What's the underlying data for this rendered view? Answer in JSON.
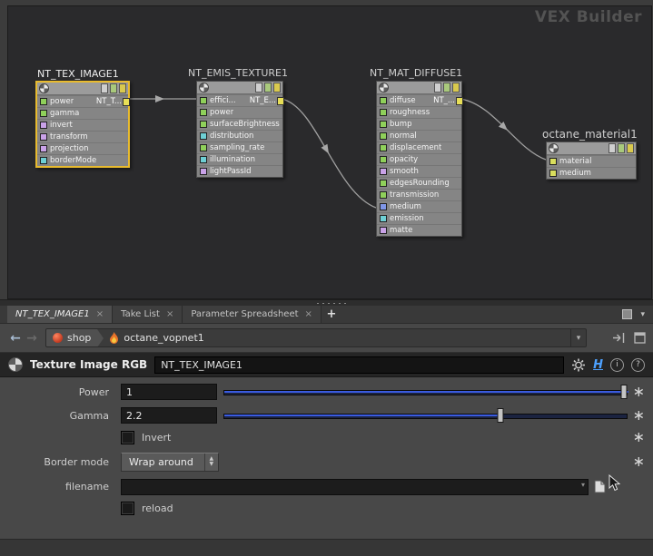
{
  "colors": {
    "selection_outline": "#e8bb2e",
    "slider_blue": "#3a5be0",
    "network_bg": "#2a2a2c",
    "pane_bg": "#484848"
  },
  "icons": {
    "back": "←",
    "forward": "→",
    "caret_down": "▾",
    "plus": "+",
    "close": "×",
    "spin_up": "▲",
    "spin_down": "▼",
    "star": "∗",
    "info": "i",
    "help": "?"
  },
  "network": {
    "watermark": "VEX Builder",
    "nodes": [
      {
        "title": "NT_TEX_IMAGE1",
        "abbrev": "NT_T...",
        "rows": [
          {
            "label": "power",
            "color": "#8fd05a"
          },
          {
            "label": "gamma",
            "color": "#8fd05a"
          },
          {
            "label": "invert",
            "color": "#c9a2e8"
          },
          {
            "label": "transform",
            "color": "#c9a2e8"
          },
          {
            "label": "projection",
            "color": "#c9a2e8"
          },
          {
            "label": "borderMode",
            "color": "#6ecfd4"
          }
        ]
      },
      {
        "title": "NT_EMIS_TEXTURE1",
        "abbrev": "NT_E...",
        "rows": [
          {
            "label": "effici...",
            "color": "#8fd05a"
          },
          {
            "label": "power",
            "color": "#8fd05a"
          },
          {
            "label": "surfaceBrightness",
            "color": "#8fd05a"
          },
          {
            "label": "distribution",
            "color": "#6ecfd4"
          },
          {
            "label": "sampling_rate",
            "color": "#8fd05a"
          },
          {
            "label": "illumination",
            "color": "#6ecfd4"
          },
          {
            "label": "lightPassId",
            "color": "#c9a2e8"
          }
        ]
      },
      {
        "title": "NT_MAT_DIFFUSE1",
        "abbrev": "NT_...",
        "rows": [
          {
            "label": "diffuse",
            "color": "#8fd05a"
          },
          {
            "label": "roughness",
            "color": "#8fd05a"
          },
          {
            "label": "bump",
            "color": "#8fd05a"
          },
          {
            "label": "normal",
            "color": "#8fd05a"
          },
          {
            "label": "displacement",
            "color": "#8fd05a"
          },
          {
            "label": "opacity",
            "color": "#8fd05a"
          },
          {
            "label": "smooth",
            "color": "#c9a2e8"
          },
          {
            "label": "edgesRounding",
            "color": "#8fd05a"
          },
          {
            "label": "transmission",
            "color": "#8fd05a"
          },
          {
            "label": "medium",
            "color": "#7f96e8"
          },
          {
            "label": "emission",
            "color": "#6ecfd4"
          },
          {
            "label": "matte",
            "color": "#c9a2e8"
          }
        ]
      },
      {
        "title": "octane_material1",
        "rows": [
          {
            "label": "material",
            "color": "#d9de5d"
          },
          {
            "label": "medium",
            "color": "#d9de5d"
          }
        ]
      }
    ]
  },
  "tabs": {
    "items": [
      {
        "label": "NT_TEX_IMAGE1"
      },
      {
        "label": "Take List"
      },
      {
        "label": "Parameter Spreadsheet"
      }
    ]
  },
  "nav": {
    "context_label": "shop",
    "net_label": "octane_vopnet1"
  },
  "header": {
    "type_label": "Texture Image RGB",
    "node_name": "NT_TEX_IMAGE1",
    "hda_label": "H"
  },
  "params": {
    "power": {
      "label": "Power",
      "value": "1",
      "fill": "100%",
      "handle": "99%"
    },
    "gamma": {
      "label": "Gamma",
      "value": "2.2",
      "fill": "68.5%",
      "handle": "68.5%"
    },
    "invert": {
      "label": "Invert"
    },
    "border_mode": {
      "label": "Border mode",
      "value": "Wrap around"
    },
    "filename": {
      "label": "filename",
      "value": ""
    },
    "reload": {
      "label": "reload"
    }
  }
}
